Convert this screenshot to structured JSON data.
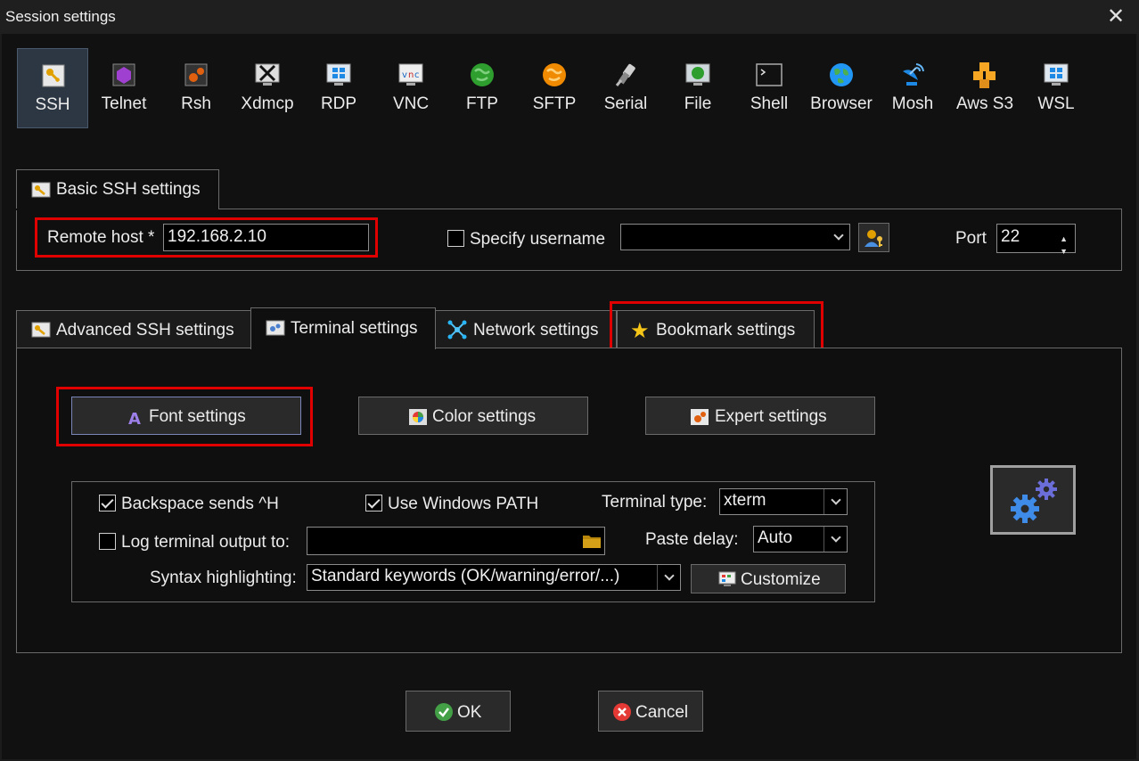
{
  "window": {
    "title": "Session settings",
    "close_glyph": "✕"
  },
  "protocols": [
    {
      "label": "SSH",
      "icon": "ssh-key-icon",
      "selected": true
    },
    {
      "label": "Telnet",
      "icon": "telnet-icon"
    },
    {
      "label": "Rsh",
      "icon": "rsh-icon"
    },
    {
      "label": "Xdmcp",
      "icon": "xdmcp-icon"
    },
    {
      "label": "RDP",
      "icon": "rdp-monitor-icon"
    },
    {
      "label": "VNC",
      "icon": "vnc-icon"
    },
    {
      "label": "FTP",
      "icon": "ftp-globe-icon"
    },
    {
      "label": "SFTP",
      "icon": "sftp-globe-icon"
    },
    {
      "label": "Serial",
      "icon": "serial-plug-icon"
    },
    {
      "label": "File",
      "icon": "file-monitor-icon"
    },
    {
      "label": "Shell",
      "icon": "shell-terminal-icon"
    },
    {
      "label": "Browser",
      "icon": "browser-globe-icon"
    },
    {
      "label": "Mosh",
      "icon": "mosh-satellite-icon"
    },
    {
      "label": "Aws S3",
      "icon": "aws-s3-cubes-icon"
    },
    {
      "label": "WSL",
      "icon": "wsl-windows-icon"
    }
  ],
  "basic": {
    "tab_label": "Basic SSH settings",
    "remote_host_label": "Remote host *",
    "remote_host_value": "192.168.2.10",
    "specify_username_label": "Specify username",
    "username_value": "",
    "port_label": "Port",
    "port_value": "22"
  },
  "tabs": [
    {
      "label": "Advanced SSH settings"
    },
    {
      "label": "Terminal settings",
      "active": true
    },
    {
      "label": "Network settings"
    },
    {
      "label": "Bookmark settings"
    }
  ],
  "terminal": {
    "font_button": "Font settings",
    "color_button": "Color settings",
    "expert_button": "Expert settings",
    "backspace_label": "Backspace sends ^H",
    "backspace_checked": true,
    "use_windows_path_label": "Use Windows PATH",
    "use_windows_path_checked": true,
    "terminal_type_label": "Terminal type:",
    "terminal_type_value": "xterm",
    "log_output_label": "Log terminal output to:",
    "log_output_checked": false,
    "log_output_value": "",
    "paste_delay_label": "Paste delay:",
    "paste_delay_value": "Auto",
    "syntax_label": "Syntax highlighting:",
    "syntax_value": "Standard keywords (OK/warning/error/...)",
    "customize_button": "Customize"
  },
  "footer": {
    "ok_label": "OK",
    "cancel_label": "Cancel"
  },
  "colors": {
    "highlight": "#e00000",
    "accent": "#2d3743"
  }
}
